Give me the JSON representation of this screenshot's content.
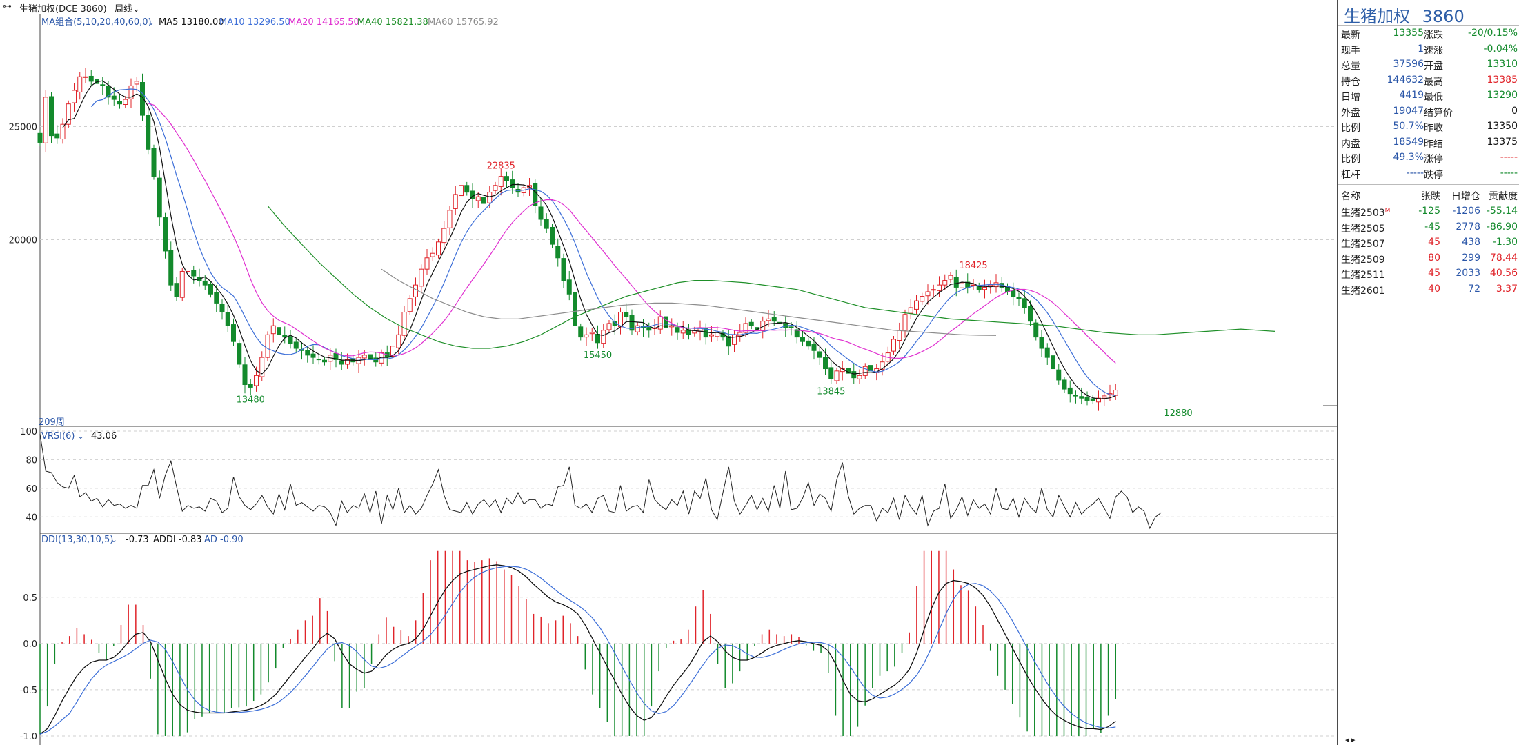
{
  "header": {
    "title": "生猪加权(DCE 3860)",
    "period": "周线",
    "ma_label": "MA组合(5,10,20,40,60,0)",
    "ma5": "MA5 13180.00",
    "ma10": "MA10 13296.50",
    "ma20": "MA20 14165.50",
    "ma40": "MA40 15821.38",
    "ma60": "MA60 15765.92",
    "bar_count": "209周"
  },
  "colors": {
    "up": "#e0242a",
    "down": "#138a2c",
    "ma5": "#111111",
    "ma10": "#3d6fd8",
    "ma20": "#e030d0",
    "ma40": "#1e8f28",
    "ma60": "#8c8c8c"
  },
  "vrsi": {
    "label": "VRSI(6)",
    "value": "43.06"
  },
  "ddi": {
    "label": "DDI(13,30,10,5)",
    "ddi": "-0.73",
    "addi": "ADDI -0.83",
    "ad": "AD -0.90"
  },
  "chart_data": [
    {
      "type": "candlestick",
      "y_ticks": [
        "25000",
        "20000"
      ],
      "annotations": [
        "22835",
        "15450",
        "13480",
        "18425",
        "13845",
        "12880"
      ],
      "closes": [
        24300,
        26300,
        24600,
        24500,
        25100,
        26000,
        26600,
        27200,
        27200,
        27000,
        26900,
        26800,
        26300,
        26200,
        26000,
        26200,
        26800,
        27000,
        25500,
        24000,
        22800,
        21000,
        19500,
        18000,
        17500,
        18600,
        18600,
        18400,
        18200,
        18000,
        17600,
        17200,
        16800,
        16200,
        15500,
        14500,
        13600,
        13480,
        14000,
        14800,
        15800,
        16200,
        15800,
        15700,
        15400,
        15200,
        15100,
        14900,
        14800,
        14700,
        14600,
        14900,
        14700,
        14500,
        14700,
        14600,
        14800,
        14900,
        14700,
        14600,
        15000,
        14800,
        15300,
        15800,
        16800,
        17400,
        18000,
        18700,
        19200,
        19400,
        19900,
        20500,
        21300,
        22000,
        22400,
        22100,
        21800,
        21900,
        21600,
        22100,
        22400,
        22800,
        22600,
        22300,
        22100,
        22300,
        22400,
        21500,
        20900,
        20500,
        19800,
        19200,
        18200,
        17600,
        16200,
        15700,
        15800,
        15900,
        15450,
        16000,
        16300,
        16200,
        16800,
        16600,
        16000,
        16200,
        16100,
        16000,
        16100,
        16600,
        16100,
        16200,
        15900,
        16000,
        15800,
        16000,
        16100,
        15700,
        15800,
        15900,
        15700,
        15300,
        15800,
        15900,
        16300,
        16200,
        16000,
        16400,
        16500,
        16400,
        16300,
        16100,
        16100,
        15700,
        15500,
        15300,
        15100,
        14800,
        14300,
        13845,
        14200,
        14300,
        14100,
        13900,
        14000,
        14400,
        14200,
        14300,
        14600,
        15000,
        15600,
        16000,
        16700,
        17000,
        17300,
        17500,
        17700,
        17800,
        18000,
        18200,
        18425,
        17900,
        18100,
        17900,
        18000,
        17800,
        17900,
        18000,
        18100,
        17900,
        17700,
        17500,
        17400,
        17000,
        16400,
        15700,
        15200,
        14800,
        14300,
        13800,
        13400,
        13200,
        13100,
        13000,
        12900,
        12880,
        13000,
        13100,
        13200,
        13355
      ],
      "ma40": {
        "start_index": 40,
        "values": [
          21500,
          20600,
          19800,
          19000,
          18300,
          17600,
          17000,
          16500,
          16100,
          15800,
          15500,
          15300,
          15200,
          15200,
          15300,
          15500,
          15800,
          16200,
          16600,
          16900,
          17200,
          17500,
          17700,
          17900,
          18100,
          18200,
          18200,
          18150,
          18100,
          18000,
          17900,
          17800,
          17600,
          17400,
          17200,
          17000,
          16900,
          16800,
          16700,
          16600,
          16500,
          16450,
          16400,
          16350,
          16300,
          16250,
          16200,
          16100,
          16000,
          15900,
          15850,
          15800,
          15800,
          15850,
          15900,
          15950,
          16000,
          16050,
          16000,
          15950
        ]
      },
      "ma60": {
        "start_index": 60,
        "values": [
          18700,
          18200,
          17800,
          17400,
          17100,
          16800,
          16600,
          16500,
          16500,
          16600,
          16700,
          16800,
          16900,
          17000,
          17100,
          17150,
          17200,
          17200,
          17150,
          17100,
          17000,
          16900,
          16800,
          16700,
          16600,
          16500,
          16400,
          16300,
          16200,
          16100,
          16000,
          15950,
          15900,
          15850,
          15800,
          15780,
          15770
        ]
      }
    },
    {
      "type": "line",
      "name": "VRSI(6)",
      "y_ticks": [
        "100",
        "80",
        "60",
        "40"
      ],
      "values": [
        98,
        72,
        71,
        64,
        61,
        60,
        69,
        54,
        57,
        51,
        53,
        47,
        52,
        48,
        49,
        46,
        48,
        46,
        62,
        62,
        73,
        53,
        69,
        79,
        61,
        44,
        48,
        46,
        47,
        44,
        53,
        51,
        43,
        46,
        68,
        54,
        48,
        45,
        49,
        55,
        47,
        42,
        56,
        45,
        63,
        48,
        50,
        47,
        44,
        48,
        47,
        43,
        34,
        51,
        43,
        48,
        46,
        56,
        43,
        58,
        35,
        55,
        45,
        60,
        43,
        48,
        42,
        46,
        55,
        63,
        73,
        55,
        45,
        44,
        43,
        50,
        42,
        49,
        52,
        47,
        52,
        43,
        53,
        49,
        57,
        49,
        52,
        52,
        46,
        49,
        48,
        61,
        62,
        75,
        48,
        46,
        49,
        43,
        53,
        55,
        44,
        43,
        62,
        44,
        47,
        48,
        43,
        66,
        52,
        48,
        45,
        52,
        48,
        58,
        42,
        58,
        53,
        67,
        45,
        38,
        57,
        75,
        51,
        42,
        48,
        55,
        45,
        53,
        44,
        62,
        46,
        72,
        45,
        46,
        53,
        64,
        48,
        56,
        53,
        44,
        66,
        78,
        55,
        42,
        46,
        48,
        48,
        37,
        46,
        43,
        53,
        38,
        55,
        47,
        42,
        55,
        34,
        44,
        46,
        63,
        39,
        45,
        54,
        41,
        52,
        46,
        49,
        42,
        60,
        46,
        45,
        53,
        40,
        53,
        47,
        43,
        60,
        45,
        40,
        55,
        47,
        40,
        50,
        42,
        46,
        49,
        53,
        46,
        39,
        54,
        58,
        54,
        43,
        47,
        44,
        32,
        40,
        43
      ]
    },
    {
      "type": "bar+line",
      "name": "DDI(13,30,10,5)",
      "y_ticks": [
        "0.5",
        "0.0",
        "-0.5",
        "-1.0"
      ],
      "addi": [
        -0.98,
        -0.92,
        -0.78,
        -0.62,
        -0.48,
        -0.35,
        -0.26,
        -0.2,
        -0.18,
        -0.18,
        -0.15,
        -0.08,
        0.02,
        0.1,
        0.12,
        0.02,
        -0.18,
        -0.38,
        -0.55,
        -0.66,
        -0.72,
        -0.74,
        -0.75,
        -0.75,
        -0.75,
        -0.75,
        -0.74,
        -0.73,
        -0.72,
        -0.7,
        -0.67,
        -0.62,
        -0.55,
        -0.45,
        -0.35,
        -0.25,
        -0.15,
        -0.06,
        0.05,
        0.11,
        0.05,
        -0.1,
        -0.22,
        -0.28,
        -0.32,
        -0.3,
        -0.22,
        -0.12,
        -0.06,
        -0.02,
        0.0,
        0.05,
        0.15,
        0.3,
        0.45,
        0.58,
        0.68,
        0.75,
        0.78,
        0.8,
        0.82,
        0.84,
        0.85,
        0.84,
        0.82,
        0.78,
        0.72,
        0.64,
        0.57,
        0.5,
        0.45,
        0.42,
        0.38,
        0.32,
        0.2,
        0.05,
        -0.1,
        -0.25,
        -0.4,
        -0.55,
        -0.68,
        -0.78,
        -0.83,
        -0.8,
        -0.7,
        -0.57,
        -0.45,
        -0.35,
        -0.25,
        -0.12,
        0.02,
        0.08,
        0.02,
        -0.08,
        -0.15,
        -0.18,
        -0.18,
        -0.15,
        -0.1,
        -0.05,
        -0.02,
        0.0,
        0.02,
        0.03,
        0.02,
        0.0,
        -0.02,
        -0.08,
        -0.22,
        -0.4,
        -0.55,
        -0.62,
        -0.63,
        -0.6,
        -0.55,
        -0.5,
        -0.45,
        -0.38,
        -0.28,
        -0.1,
        0.15,
        0.38,
        0.55,
        0.65,
        0.68,
        0.67,
        0.65,
        0.6,
        0.52,
        0.4,
        0.25,
        0.1,
        -0.05,
        -0.2,
        -0.35,
        -0.48,
        -0.6,
        -0.7,
        -0.78,
        -0.83,
        -0.87,
        -0.9,
        -0.92,
        -0.92,
        -0.93,
        -0.9,
        -0.84
      ]
    }
  ],
  "quote": {
    "title": "生猪加权",
    "code": "3860",
    "rows": [
      {
        "k1": "最新",
        "v1": "13355",
        "c1": "dn",
        "k2": "涨跌",
        "v2": "-20/0.15%",
        "c2": "dn"
      },
      {
        "k1": "现手",
        "v1": "1",
        "c1": "nv",
        "k2": "速涨",
        "v2": "-0.04%",
        "c2": "dn"
      },
      {
        "k1": "总量",
        "v1": "37596",
        "c1": "nv",
        "k2": "开盘",
        "v2": "13310",
        "c2": "dn"
      },
      {
        "k1": "持仓",
        "v1": "144632",
        "c1": "nv",
        "k2": "最高",
        "v2": "13385",
        "c2": "up"
      },
      {
        "k1": "日增",
        "v1": "4419",
        "c1": "nv",
        "k2": "最低",
        "v2": "13290",
        "c2": "dn"
      },
      {
        "k1": "外盘",
        "v1": "19047",
        "c1": "nv",
        "k2": "结算价",
        "v2": "0",
        "c2": "blk"
      },
      {
        "k1": "比例",
        "v1": "50.7%",
        "c1": "nv",
        "k2": "昨收",
        "v2": "13350",
        "c2": "blk"
      },
      {
        "k1": "内盘",
        "v1": "18549",
        "c1": "nv",
        "k2": "昨结",
        "v2": "13375",
        "c2": "blk"
      },
      {
        "k1": "比例",
        "v1": "49.3%",
        "c1": "nv",
        "k2": "涨停",
        "v2": "-----",
        "c2": "up"
      },
      {
        "k1": "杠杆",
        "v1": "-----",
        "c1": "nv",
        "k2": "跌停",
        "v2": "-----",
        "c2": "dn"
      }
    ],
    "table_header": [
      "名称",
      "张跌",
      "日增仓",
      "贡献度"
    ],
    "contracts": [
      {
        "name": "生猪2503",
        "mark": "M",
        "chg": "-125",
        "chg_c": "dn",
        "oi": "-1206",
        "contrib": "-55.14",
        "contrib_c": "dn"
      },
      {
        "name": "生猪2505",
        "mark": "",
        "chg": "-45",
        "chg_c": "dn",
        "oi": "2778",
        "contrib": "-86.90",
        "contrib_c": "dn"
      },
      {
        "name": "生猪2507",
        "mark": "",
        "chg": "45",
        "chg_c": "up",
        "oi": "438",
        "contrib": "-1.30",
        "contrib_c": "dn"
      },
      {
        "name": "生猪2509",
        "mark": "",
        "chg": "80",
        "chg_c": "up",
        "oi": "299",
        "contrib": "78.44",
        "contrib_c": "up"
      },
      {
        "name": "生猪2511",
        "mark": "",
        "chg": "45",
        "chg_c": "up",
        "oi": "2033",
        "contrib": "40.56",
        "contrib_c": "up"
      },
      {
        "name": "生猪2601",
        "mark": "",
        "chg": "40",
        "chg_c": "up",
        "oi": "72",
        "contrib": "3.37",
        "contrib_c": "up"
      }
    ]
  }
}
